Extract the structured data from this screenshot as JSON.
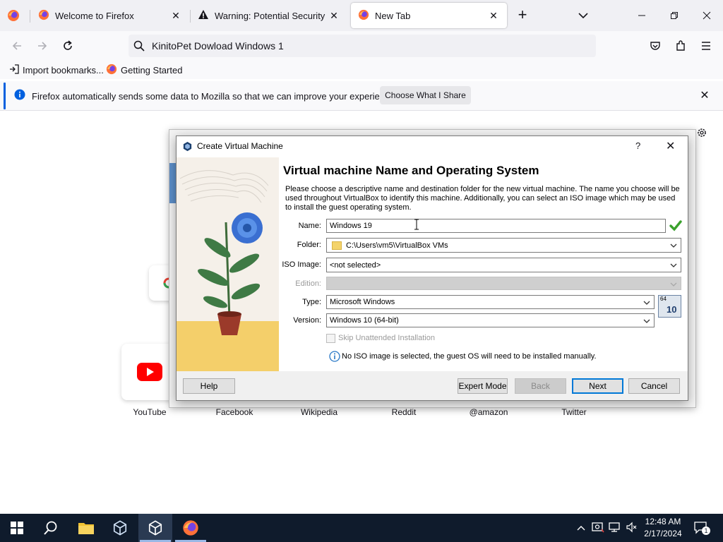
{
  "browser": {
    "tabs": [
      {
        "title": "Welcome to Firefox",
        "close": "✕"
      },
      {
        "title": "Warning: Potential Security Risk",
        "close": "✕"
      },
      {
        "title": "New Tab",
        "close": "✕"
      }
    ],
    "new_tab_symbol": "+",
    "address": "KinitoPet Dowload Windows 1",
    "bookmarks": [
      "Import bookmarks...",
      "Getting Started"
    ],
    "notification": {
      "text": "Firefox automatically sends some data to Mozilla so that we can improve your experience.",
      "button": "Choose What I Share",
      "close": "✕"
    },
    "accent_color": "#0060df"
  },
  "newtab": {
    "shortcuts": [
      "YouTube",
      "Facebook",
      "Wikipedia",
      "Reddit",
      "@amazon",
      "Twitter"
    ]
  },
  "dialog": {
    "title": "Create Virtual Machine",
    "help_symbol": "?",
    "close_symbol": "✕",
    "heading": "Virtual machine Name and Operating System",
    "description": "Please choose a descriptive name and destination folder for the new virtual machine. The name you choose will be used throughout VirtualBox to identify this machine. Additionally, you can select an ISO image which may be used to install the guest operating system.",
    "fields": {
      "name_label": "Name:",
      "name_value": "Windows 19",
      "folder_label": "Folder:",
      "folder_value": "C:\\Users\\vm5\\VirtualBox VMs",
      "iso_label": "ISO Image:",
      "iso_value": "<not selected>",
      "edition_label": "Edition:",
      "edition_value": "",
      "type_label": "Type:",
      "type_value": "Microsoft Windows",
      "version_label": "Version:",
      "version_value": "Windows 10 (64-bit)",
      "os_badge_top": "64",
      "os_badge_bottom": "10"
    },
    "skip_unattended": {
      "label": "Skip Unattended Installation",
      "checked": false,
      "enabled": false
    },
    "info_message": "No ISO image is selected, the guest OS will need to be installed manually.",
    "buttons": {
      "help": "Help",
      "expert": "Expert Mode",
      "back": "Back",
      "next": "Next",
      "cancel": "Cancel"
    }
  },
  "taskbar": {
    "time": "12:48 AM",
    "date": "2/17/2024",
    "notification_count": "1"
  }
}
